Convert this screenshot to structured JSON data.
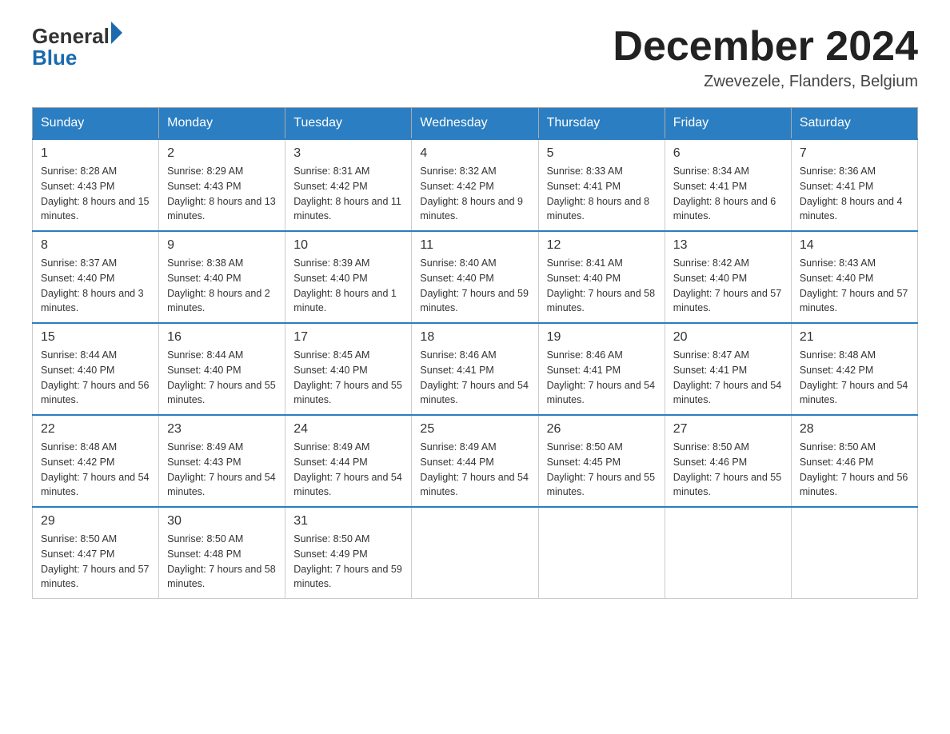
{
  "header": {
    "logo_general": "General",
    "logo_blue": "Blue",
    "month_title": "December 2024",
    "subtitle": "Zwevezele, Flanders, Belgium"
  },
  "weekdays": [
    "Sunday",
    "Monday",
    "Tuesday",
    "Wednesday",
    "Thursday",
    "Friday",
    "Saturday"
  ],
  "weeks": [
    [
      {
        "day": "1",
        "sunrise": "8:28 AM",
        "sunset": "4:43 PM",
        "daylight": "8 hours and 15 minutes."
      },
      {
        "day": "2",
        "sunrise": "8:29 AM",
        "sunset": "4:43 PM",
        "daylight": "8 hours and 13 minutes."
      },
      {
        "day": "3",
        "sunrise": "8:31 AM",
        "sunset": "4:42 PM",
        "daylight": "8 hours and 11 minutes."
      },
      {
        "day": "4",
        "sunrise": "8:32 AM",
        "sunset": "4:42 PM",
        "daylight": "8 hours and 9 minutes."
      },
      {
        "day": "5",
        "sunrise": "8:33 AM",
        "sunset": "4:41 PM",
        "daylight": "8 hours and 8 minutes."
      },
      {
        "day": "6",
        "sunrise": "8:34 AM",
        "sunset": "4:41 PM",
        "daylight": "8 hours and 6 minutes."
      },
      {
        "day": "7",
        "sunrise": "8:36 AM",
        "sunset": "4:41 PM",
        "daylight": "8 hours and 4 minutes."
      }
    ],
    [
      {
        "day": "8",
        "sunrise": "8:37 AM",
        "sunset": "4:40 PM",
        "daylight": "8 hours and 3 minutes."
      },
      {
        "day": "9",
        "sunrise": "8:38 AM",
        "sunset": "4:40 PM",
        "daylight": "8 hours and 2 minutes."
      },
      {
        "day": "10",
        "sunrise": "8:39 AM",
        "sunset": "4:40 PM",
        "daylight": "8 hours and 1 minute."
      },
      {
        "day": "11",
        "sunrise": "8:40 AM",
        "sunset": "4:40 PM",
        "daylight": "7 hours and 59 minutes."
      },
      {
        "day": "12",
        "sunrise": "8:41 AM",
        "sunset": "4:40 PM",
        "daylight": "7 hours and 58 minutes."
      },
      {
        "day": "13",
        "sunrise": "8:42 AM",
        "sunset": "4:40 PM",
        "daylight": "7 hours and 57 minutes."
      },
      {
        "day": "14",
        "sunrise": "8:43 AM",
        "sunset": "4:40 PM",
        "daylight": "7 hours and 57 minutes."
      }
    ],
    [
      {
        "day": "15",
        "sunrise": "8:44 AM",
        "sunset": "4:40 PM",
        "daylight": "7 hours and 56 minutes."
      },
      {
        "day": "16",
        "sunrise": "8:44 AM",
        "sunset": "4:40 PM",
        "daylight": "7 hours and 55 minutes."
      },
      {
        "day": "17",
        "sunrise": "8:45 AM",
        "sunset": "4:40 PM",
        "daylight": "7 hours and 55 minutes."
      },
      {
        "day": "18",
        "sunrise": "8:46 AM",
        "sunset": "4:41 PM",
        "daylight": "7 hours and 54 minutes."
      },
      {
        "day": "19",
        "sunrise": "8:46 AM",
        "sunset": "4:41 PM",
        "daylight": "7 hours and 54 minutes."
      },
      {
        "day": "20",
        "sunrise": "8:47 AM",
        "sunset": "4:41 PM",
        "daylight": "7 hours and 54 minutes."
      },
      {
        "day": "21",
        "sunrise": "8:48 AM",
        "sunset": "4:42 PM",
        "daylight": "7 hours and 54 minutes."
      }
    ],
    [
      {
        "day": "22",
        "sunrise": "8:48 AM",
        "sunset": "4:42 PM",
        "daylight": "7 hours and 54 minutes."
      },
      {
        "day": "23",
        "sunrise": "8:49 AM",
        "sunset": "4:43 PM",
        "daylight": "7 hours and 54 minutes."
      },
      {
        "day": "24",
        "sunrise": "8:49 AM",
        "sunset": "4:44 PM",
        "daylight": "7 hours and 54 minutes."
      },
      {
        "day": "25",
        "sunrise": "8:49 AM",
        "sunset": "4:44 PM",
        "daylight": "7 hours and 54 minutes."
      },
      {
        "day": "26",
        "sunrise": "8:50 AM",
        "sunset": "4:45 PM",
        "daylight": "7 hours and 55 minutes."
      },
      {
        "day": "27",
        "sunrise": "8:50 AM",
        "sunset": "4:46 PM",
        "daylight": "7 hours and 55 minutes."
      },
      {
        "day": "28",
        "sunrise": "8:50 AM",
        "sunset": "4:46 PM",
        "daylight": "7 hours and 56 minutes."
      }
    ],
    [
      {
        "day": "29",
        "sunrise": "8:50 AM",
        "sunset": "4:47 PM",
        "daylight": "7 hours and 57 minutes."
      },
      {
        "day": "30",
        "sunrise": "8:50 AM",
        "sunset": "4:48 PM",
        "daylight": "7 hours and 58 minutes."
      },
      {
        "day": "31",
        "sunrise": "8:50 AM",
        "sunset": "4:49 PM",
        "daylight": "7 hours and 59 minutes."
      },
      null,
      null,
      null,
      null
    ]
  ]
}
